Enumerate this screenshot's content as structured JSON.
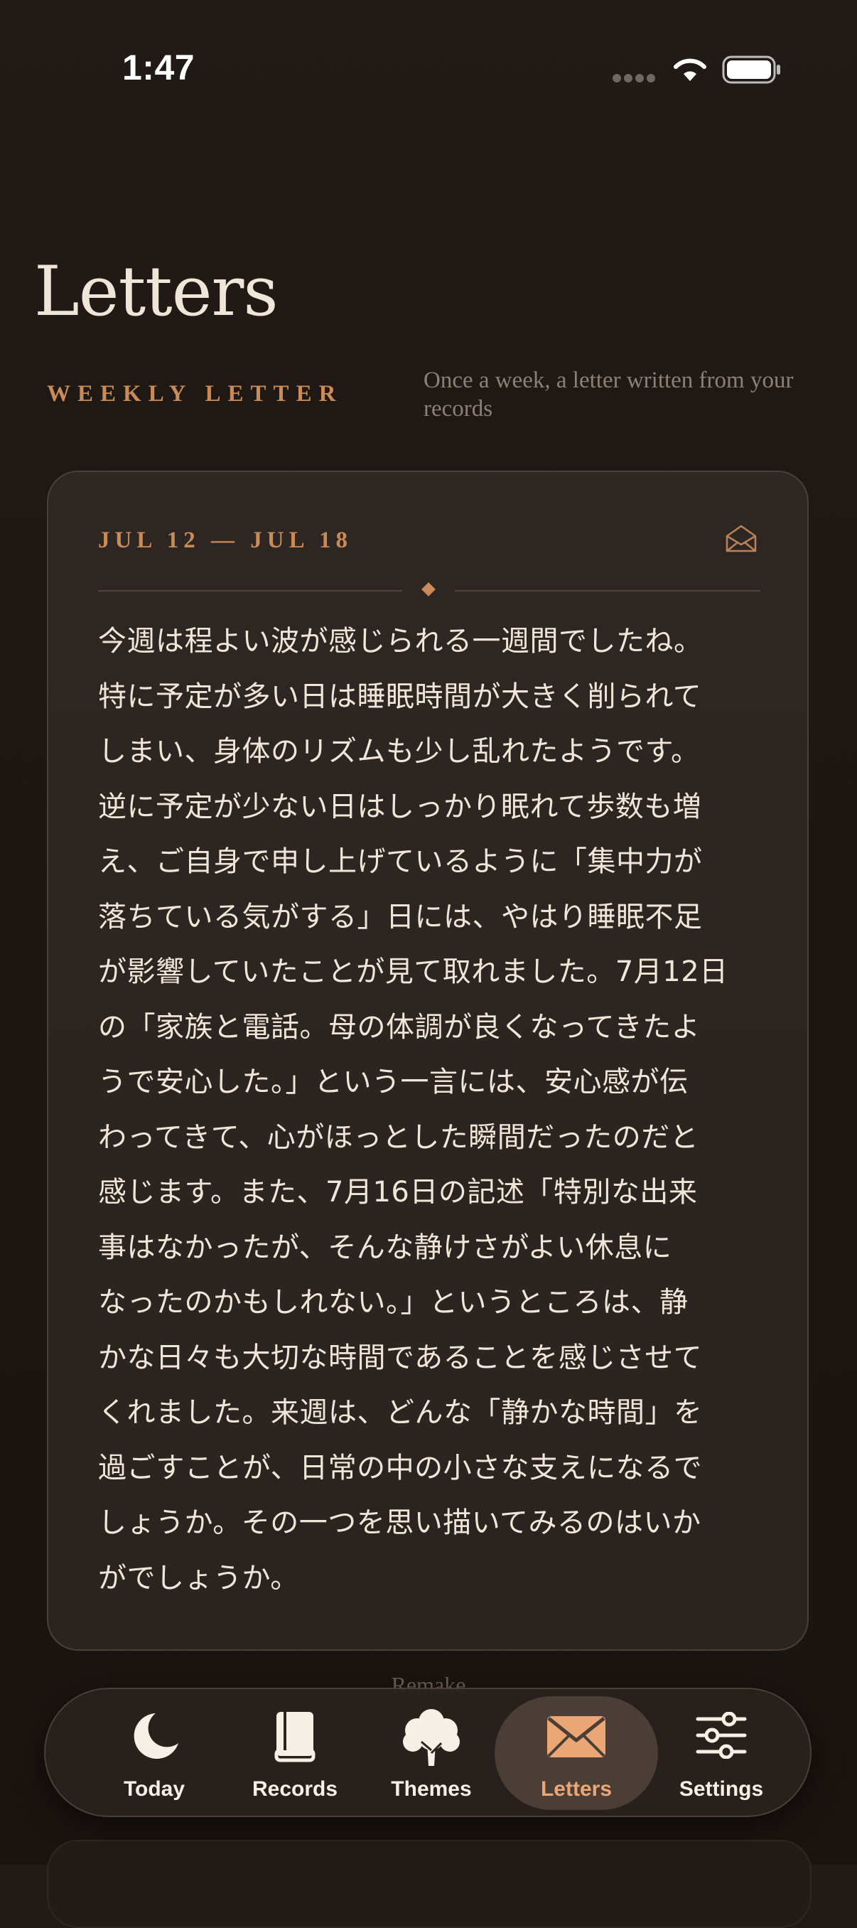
{
  "status_bar": {
    "time": "1:47"
  },
  "page": {
    "title": "Letters",
    "section_label": "WEEKLY LETTER",
    "section_description": "Once a week, a letter written from your records"
  },
  "letter": {
    "date_range": "JUL 12 — JUL 18",
    "icon": "envelope-open-icon",
    "lines": [
      "今週は程よい波が感じられる一週間でしたね。",
      "特に予定が多い日は睡眠時間が大きく削られて",
      "しまい、身体のリズムも少し乱れたようです。",
      "逆に予定が少ない日はしっかり眠れて歩数も増",
      "え、ご自身で申し上げているように「集中力が",
      "落ちている気がする」日には、やはり睡眠不足",
      "が影響していたことが見て取れました。7月12日",
      "の「家族と電話。母の体調が良くなってきたよ",
      "うで安心した。」という一言には、安心感が伝",
      "わってきて、心がほっとした瞬間だったのだと",
      "感じます。また、7月16日の記述「特別な出来",
      "事はなかったが、そんな静けさがよい休息に",
      "なったのかもしれない。」というところは、静",
      "かな日々も大切な時間であることを感じさせて",
      "くれました。来週は、どんな「静かな時間」を",
      "過ごすことが、日常の中の小さな支えになるで",
      "しょうか。その一つを思い描いてみるのはいか",
      "がでしょうか。"
    ]
  },
  "below_card": {
    "remake_label": "Remake"
  },
  "tab_bar": {
    "active": "letters",
    "accent_color": "#eba676",
    "tabs": [
      {
        "id": "today",
        "label": "Today",
        "icon": "moon-icon"
      },
      {
        "id": "records",
        "label": "Records",
        "icon": "book-icon"
      },
      {
        "id": "themes",
        "label": "Themes",
        "icon": "tree-icon"
      },
      {
        "id": "letters",
        "label": "Letters",
        "icon": "envelope-icon"
      },
      {
        "id": "settings",
        "label": "Settings",
        "icon": "sliders-icon"
      }
    ]
  }
}
